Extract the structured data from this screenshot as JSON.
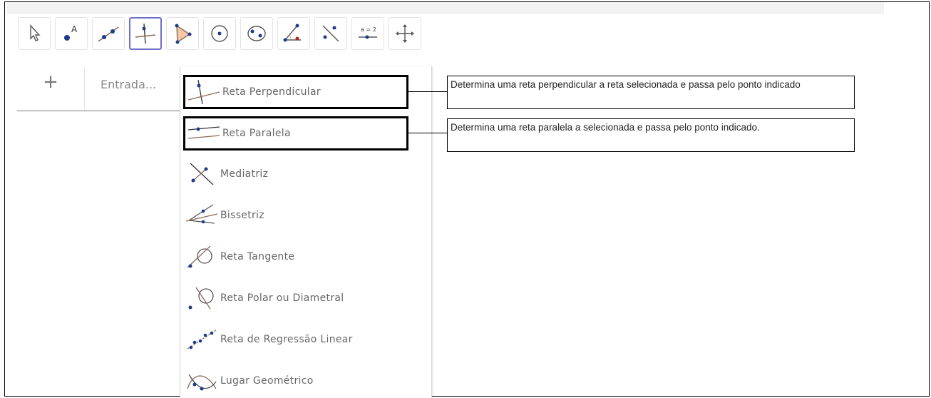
{
  "toolbar": {
    "tools": [
      {
        "name": "move-tool",
        "icon": "arrow-cursor-icon"
      },
      {
        "name": "point-tool",
        "icon": "point-icon",
        "label": "A"
      },
      {
        "name": "line-tool",
        "icon": "line-icon"
      },
      {
        "name": "perpendicular-line-tool",
        "icon": "perpendicular-icon",
        "active": true
      },
      {
        "name": "polygon-tool",
        "icon": "polygon-icon"
      },
      {
        "name": "circle-tool",
        "icon": "circle-icon"
      },
      {
        "name": "ellipse-tool",
        "icon": "ellipse-icon"
      },
      {
        "name": "angle-tool",
        "icon": "angle-icon"
      },
      {
        "name": "reflect-tool",
        "icon": "reflect-icon"
      },
      {
        "name": "slider-tool",
        "icon": "slider-icon",
        "label": "a = 2"
      },
      {
        "name": "move-graphics-tool",
        "icon": "move-graphics-icon"
      }
    ],
    "active_color": "#6d70c8"
  },
  "algebra": {
    "plus_label": "+",
    "input_placeholder": "Entrada..."
  },
  "menu": {
    "items": [
      {
        "label": "Reta Perpendicular",
        "icon": "perpendicular-line-icon"
      },
      {
        "label": "Reta Paralela",
        "icon": "parallel-line-icon"
      },
      {
        "label": "Mediatriz",
        "icon": "perpendicular-bisector-icon"
      },
      {
        "label": "Bissetriz",
        "icon": "angle-bisector-icon"
      },
      {
        "label": "Reta Tangente",
        "icon": "tangent-icon"
      },
      {
        "label": "Reta Polar ou Diametral",
        "icon": "polar-line-icon"
      },
      {
        "label": "Reta de Regressão Linear",
        "icon": "regression-icon"
      },
      {
        "label": "Lugar Geométrico",
        "icon": "locus-icon"
      }
    ]
  },
  "callouts": {
    "perpendicular": "Determina uma reta perpendicular a reta selecionada e passa pelo ponto indicado",
    "parallel": "Determina uma reta paralela a selecionada e passa pelo ponto indicado."
  },
  "colors": {
    "point_blue": "#1e3a8a",
    "line_brown": "#8a6a5a",
    "accent_purple": "#6d70c8"
  }
}
